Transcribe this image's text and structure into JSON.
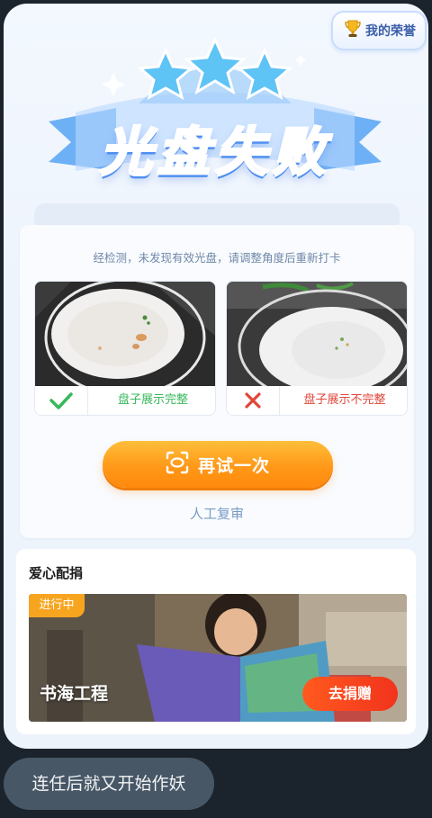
{
  "honor": {
    "label": "我的荣誉",
    "icon": "trophy-icon"
  },
  "banner": {
    "title": "光盘失败"
  },
  "result": {
    "message": "经检测，未发现有效光盘，请调整角度后重新打卡",
    "examples": [
      {
        "status": "correct",
        "caption": "盘子展示完整",
        "icon": "check-icon"
      },
      {
        "status": "incorrect",
        "caption": "盘子展示不完整",
        "icon": "cross-icon"
      }
    ],
    "retry_label": "再试一次",
    "manual_review_label": "人工复审"
  },
  "donation": {
    "title": "爱心配捐",
    "status_tag": "进行中",
    "project_name": "书海工程",
    "donate_label": "去捐赠"
  },
  "bubble": {
    "text": "连任后就又开始作妖"
  },
  "colors": {
    "page_bg": "#1b232c",
    "ok": "#38b85b",
    "bad": "#e0463a",
    "primary_orange": "#ff9616",
    "donate_red": "#f2331d"
  }
}
